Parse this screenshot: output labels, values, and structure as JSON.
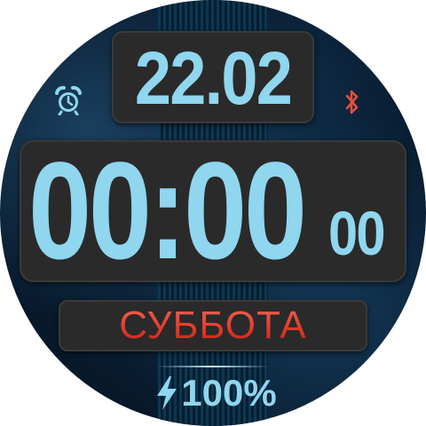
{
  "date": "22.02",
  "time": {
    "hours_minutes": "00:00",
    "seconds": "00"
  },
  "day_of_week": "СУББОТА",
  "battery": {
    "level_text": "100%",
    "level_fraction": 1.0
  },
  "icons": {
    "alarm": "alarm-clock-icon",
    "bluetooth": "bluetooth-icon",
    "charge": "lightning-bolt-icon"
  },
  "colors": {
    "digits": "#8fd6ee",
    "day_text": "#e23a2a",
    "bluetooth": "#e0503c",
    "panel": "#2a2a2a"
  }
}
